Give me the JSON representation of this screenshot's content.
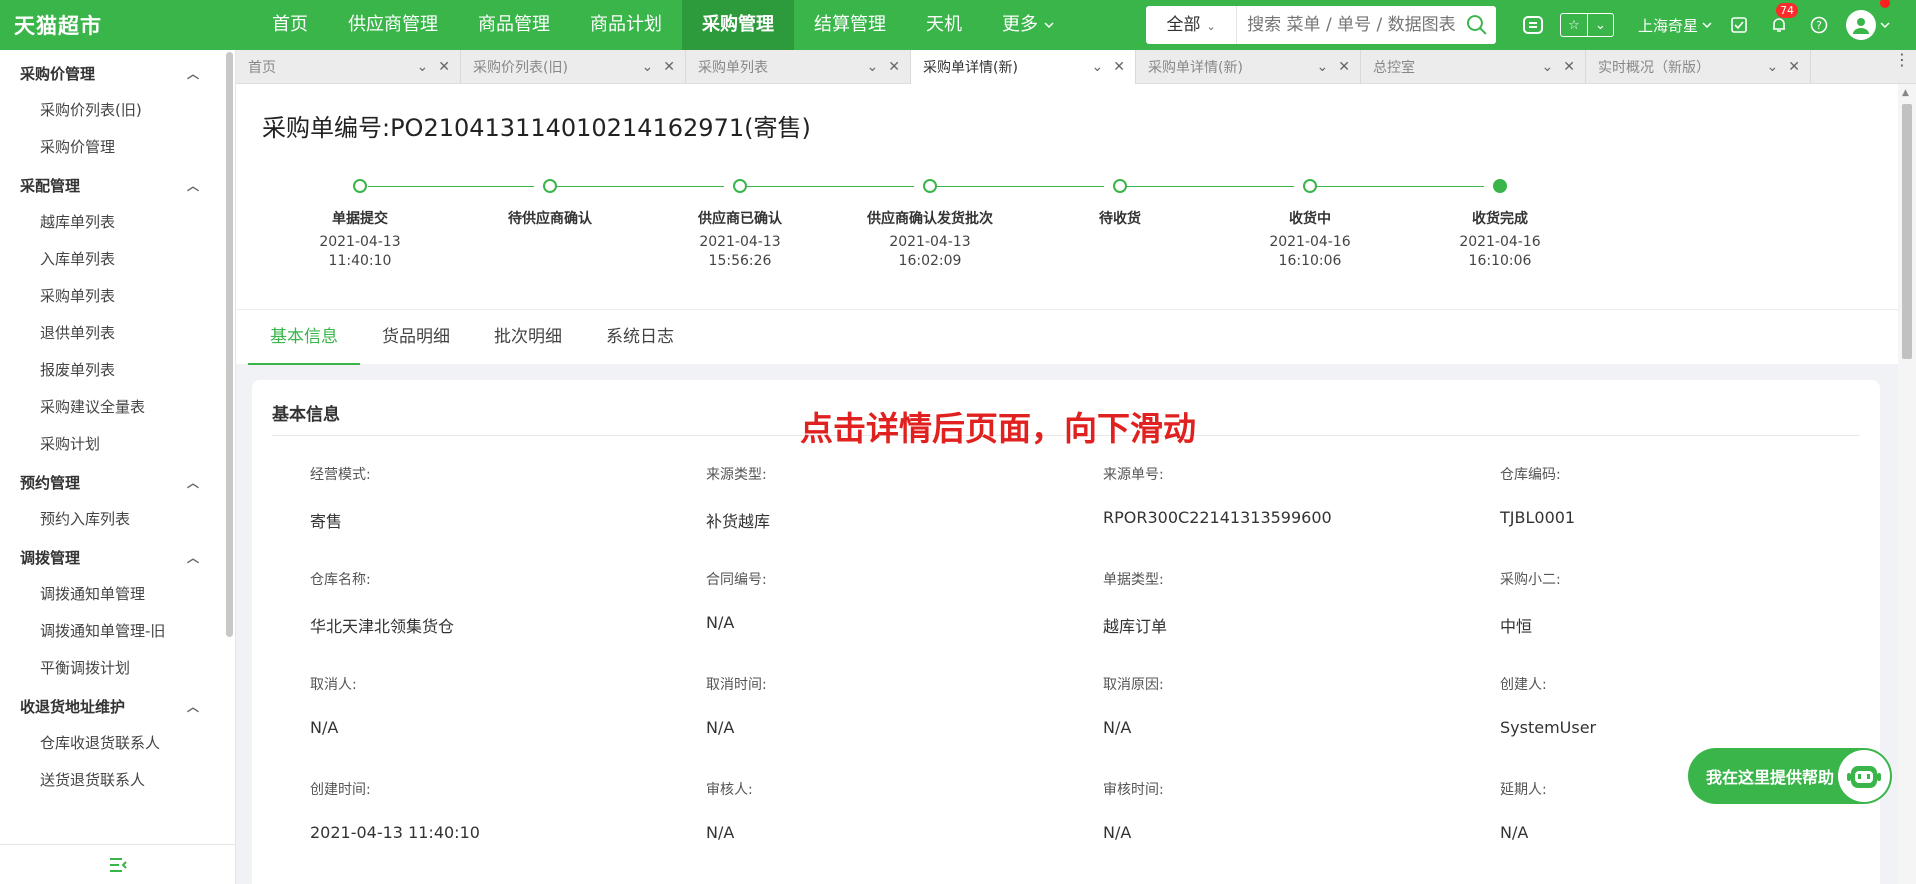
{
  "app": {
    "logo": "天猫超市",
    "nav": [
      {
        "label": "首页",
        "active": false
      },
      {
        "label": "供应商管理",
        "active": false
      },
      {
        "label": "商品管理",
        "active": false
      },
      {
        "label": "商品计划",
        "active": false
      },
      {
        "label": "采购管理",
        "active": true
      },
      {
        "label": "结算管理",
        "active": false
      },
      {
        "label": "天机",
        "active": false
      }
    ],
    "nav_more": "更多",
    "search": {
      "scope": "全部",
      "placeholder": "搜索 菜单 / 单号 / 数据图表"
    },
    "store": "上海奇星",
    "notifications": "74"
  },
  "sidebar": {
    "groups": [
      {
        "title": "采购价管理",
        "items": [
          "采购价列表(旧)",
          "采购价管理"
        ]
      },
      {
        "title": "采配管理",
        "items": [
          "越库单列表",
          "入库单列表",
          "采购单列表",
          "退供单列表",
          "报废单列表",
          "采购建议全量表",
          "采购计划"
        ]
      },
      {
        "title": "预约管理",
        "items": [
          "预约入库列表"
        ]
      },
      {
        "title": "调拨管理",
        "items": [
          "调拨通知单管理",
          "调拨通知单管理-旧",
          "平衡调拨计划"
        ]
      },
      {
        "title": "收退货地址维护",
        "items": [
          "仓库收退货联系人",
          "送货退货联系人"
        ]
      }
    ]
  },
  "tabs": [
    {
      "label": "首页",
      "active": false
    },
    {
      "label": "采购价列表(旧)",
      "active": false
    },
    {
      "label": "采购单列表",
      "active": false
    },
    {
      "label": "采购单详情(新)",
      "active": true
    },
    {
      "label": "采购单详情(新)",
      "active": false
    },
    {
      "label": "总控室",
      "active": false
    },
    {
      "label": "实时概况（新版）",
      "active": false
    }
  ],
  "detail": {
    "title": "采购单编号:PO210413114010214162971(寄售)",
    "steps": [
      {
        "name": "单据提交",
        "date": "2021-04-13",
        "time": "11:40:10",
        "done": false
      },
      {
        "name": "待供应商确认",
        "date": "",
        "time": "",
        "done": false
      },
      {
        "name": "供应商已确认",
        "date": "2021-04-13",
        "time": "15:56:26",
        "done": false
      },
      {
        "name": "供应商确认发货批次",
        "date": "2021-04-13",
        "time": "16:02:09",
        "done": false
      },
      {
        "name": "待收货",
        "date": "",
        "time": "",
        "done": false
      },
      {
        "name": "收货中",
        "date": "2021-04-16",
        "time": "16:10:06",
        "done": false
      },
      {
        "name": "收货完成",
        "date": "2021-04-16",
        "time": "16:10:06",
        "done": true
      }
    ],
    "subtabs": [
      "基本信息",
      "货品明细",
      "批次明细",
      "系统日志"
    ],
    "info_title": "基本信息",
    "annotation": "点击详情后页面，向下滑动",
    "fields": [
      {
        "label": "经营模式:",
        "value": "寄售"
      },
      {
        "label": "来源类型:",
        "value": "补货越库"
      },
      {
        "label": "来源单号:",
        "value": "RPOR300C22141313599600"
      },
      {
        "label": "仓库编码:",
        "value": "TJBL0001"
      },
      {
        "label": "仓库名称:",
        "value": "华北天津北领集货仓"
      },
      {
        "label": "合同编号:",
        "value": "N/A"
      },
      {
        "label": "单据类型:",
        "value": "越库订单"
      },
      {
        "label": "采购小二:",
        "value": "中恒"
      },
      {
        "label": "取消人:",
        "value": "N/A"
      },
      {
        "label": "取消时间:",
        "value": "N/A"
      },
      {
        "label": "取消原因:",
        "value": "N/A"
      },
      {
        "label": "创建人:",
        "value": "SystemUser"
      },
      {
        "label": "创建时间:",
        "value": "2021-04-13 11:40:10"
      },
      {
        "label": "审核人:",
        "value": "N/A"
      },
      {
        "label": "审核时间:",
        "value": "N/A"
      },
      {
        "label": "延期人:",
        "value": "N/A"
      }
    ]
  },
  "help": "我在这里提供帮助",
  "colors": {
    "brand": "#39b54a",
    "annotation": "#e0211f"
  }
}
